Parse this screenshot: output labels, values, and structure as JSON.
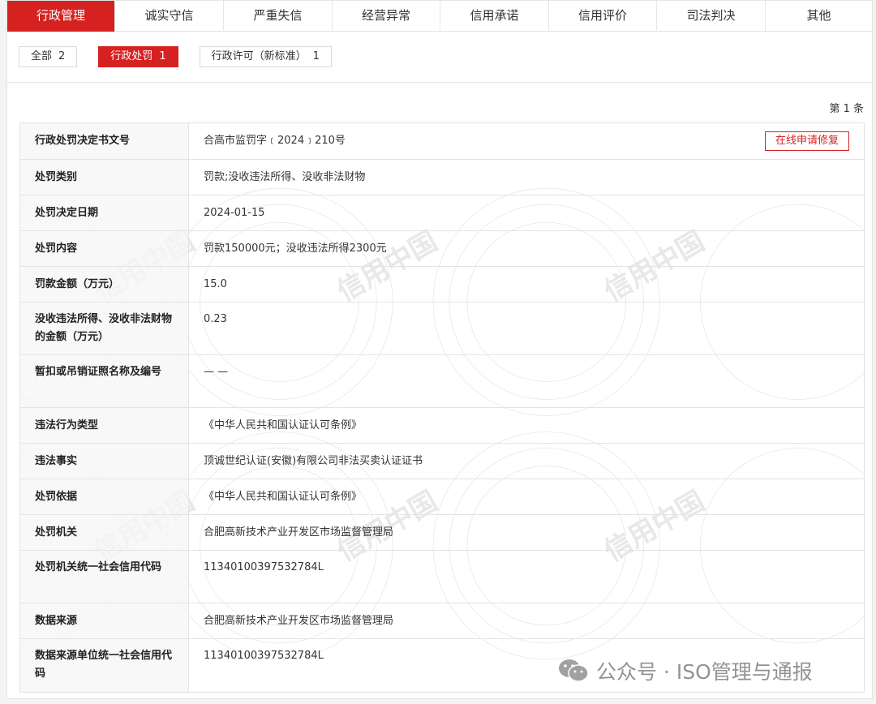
{
  "tabs": [
    {
      "label": "行政管理",
      "active": true
    },
    {
      "label": "诚实守信",
      "active": false
    },
    {
      "label": "严重失信",
      "active": false
    },
    {
      "label": "经营异常",
      "active": false
    },
    {
      "label": "信用承诺",
      "active": false
    },
    {
      "label": "信用评价",
      "active": false
    },
    {
      "label": "司法判决",
      "active": false
    },
    {
      "label": "其他",
      "active": false
    }
  ],
  "filters": [
    {
      "label": "全部",
      "count": "2",
      "active": false
    },
    {
      "label": "行政处罚",
      "count": "1",
      "active": true
    },
    {
      "label": "行政许可（新标准）",
      "count": "1",
      "active": false
    }
  ],
  "result_count": "第 1 条",
  "repair_button": "在线申请修复",
  "record": [
    {
      "label": "行政处罚决定书文号",
      "value": "合高市监罚字﹝2024﹞210号"
    },
    {
      "label": "处罚类别",
      "value": "罚款;没收违法所得、没收非法财物"
    },
    {
      "label": "处罚决定日期",
      "value": "2024-01-15"
    },
    {
      "label": "处罚内容",
      "value": "罚款150000元；没收违法所得2300元"
    },
    {
      "label": "罚款金额（万元）",
      "value": "15.0"
    },
    {
      "label": "没收违法所得、没收非法财物的金额（万元）",
      "value": "0.23"
    },
    {
      "label": "暂扣或吊销证照名称及编号",
      "value": "— —"
    },
    {
      "label": "违法行为类型",
      "value": "《中华人民共和国认证认可条例》"
    },
    {
      "label": "违法事实",
      "value": "顶诚世纪认证(安徽)有限公司非法买卖认证证书"
    },
    {
      "label": "处罚依据",
      "value": "《中华人民共和国认证认可条例》"
    },
    {
      "label": "处罚机关",
      "value": "合肥高新技术产业开发区市场监督管理局"
    },
    {
      "label": "处罚机关统一社会信用代码",
      "value": "11340100397532784L"
    },
    {
      "label": "数据来源",
      "value": "合肥高新技术产业开发区市场监督管理局"
    },
    {
      "label": "数据来源单位统一社会信用代码",
      "value": "11340100397532784L"
    }
  ],
  "watermark_text": "信用中国",
  "overlay": {
    "text": "公众号 · ISO管理与通报",
    "icon": "wechat-icon"
  },
  "colors": {
    "accent": "#d62121",
    "label_bg": "#f6f6f6",
    "border": "#e4e4e4"
  }
}
